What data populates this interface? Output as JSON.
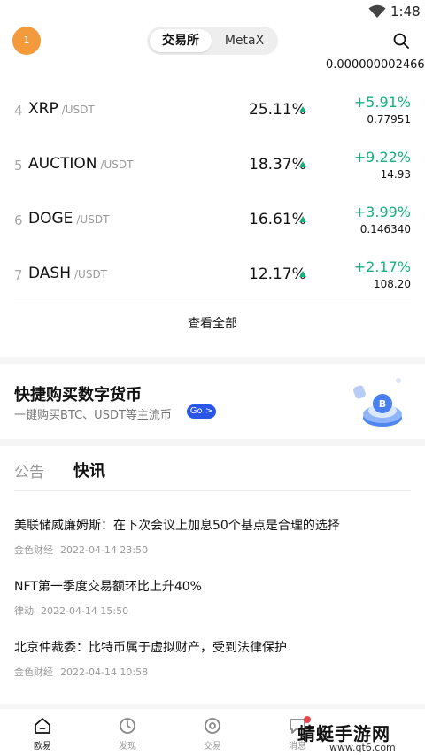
{
  "status_bar": {
    "time": "1:48",
    "wifi_icon": "wifi-icon"
  },
  "header": {
    "avatar_badge": "1",
    "tabs": [
      "交易所",
      "MetaX"
    ],
    "search_icon": "search-icon"
  },
  "partial_row": {
    "price": "0.000000002466"
  },
  "gainers": [
    {
      "rank": "4",
      "symbol": "XRP",
      "quote": "/USDT",
      "percent": "25.11%",
      "change": "+5.91%",
      "price": "0.77951"
    },
    {
      "rank": "5",
      "symbol": "AUCTION",
      "quote": "/USDT",
      "percent": "18.37%",
      "change": "+9.22%",
      "price": "14.93"
    },
    {
      "rank": "6",
      "symbol": "DOGE",
      "quote": "/USDT",
      "percent": "16.61%",
      "change": "+3.99%",
      "price": "0.146340"
    },
    {
      "rank": "7",
      "symbol": "DASH",
      "quote": "/USDT",
      "percent": "12.17%",
      "change": "+2.17%",
      "price": "108.20"
    }
  ],
  "view_all": "查看全部",
  "promo": {
    "title": "快捷购买数字货币",
    "subtitle": "一键购买BTC、USDT等主流币",
    "go_label": "Go >"
  },
  "news_tabs": [
    "公告",
    "快讯"
  ],
  "news": [
    {
      "headline": "美联储威廉姆斯：在下次会议上加息50个基点是合理的选择",
      "source": "金色财经",
      "time": "2022-04-14 23:50"
    },
    {
      "headline": "NFT第一季度交易额环比上升40%",
      "source": "律动",
      "time": "2022-04-14 15:50"
    },
    {
      "headline": "北京仲裁委：比特币属于虚拟财产，受到法律保护",
      "source": "金色财经",
      "time": "2022-04-14 10:58"
    }
  ],
  "bottom_nav": [
    {
      "label": "欧易",
      "icon": "home-icon"
    },
    {
      "label": "发现",
      "icon": "discover-icon"
    },
    {
      "label": "交易",
      "icon": "trade-icon"
    },
    {
      "label": "消息",
      "icon": "message-icon"
    }
  ],
  "watermark": {
    "text": "蜻蜓手游网",
    "url": "www.qt6.com"
  },
  "colors": {
    "up_green": "#17b07b",
    "avatar_orange": "#f39a3c",
    "go_blue": "#2a56e8"
  }
}
